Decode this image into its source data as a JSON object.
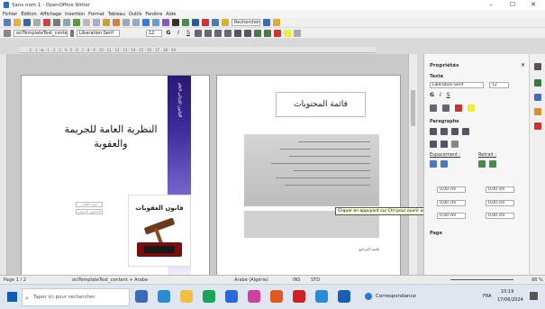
{
  "window": {
    "title": "Sans nom 1 - OpenOffice Writer",
    "minimize": "–",
    "maximize": "☐",
    "close": "✕"
  },
  "menu": [
    "Fichier",
    "Édition",
    "Affichage",
    "Insertion",
    "Format",
    "Tableau",
    "Outils",
    "Fenêtre",
    "Aide"
  ],
  "toolbar": {
    "search_field": "Rechercher",
    "style_combo": "ociTemplateText_content",
    "font_combo": "Liberation Serif",
    "size_combo": "12",
    "bold": "G",
    "italic": "I",
    "underline": "S"
  },
  "ruler": {
    "ticks": "· 2 · 1 · ⊠ · 1 · 2 · 3 · 4 · 5 · 6 · 7 · 8 · 9 · 10 · 11 · 12 · 13 · 14 · 15 · 16 · 17 · 18 · 19"
  },
  "page1": {
    "title": "النظرية العامة للجريمة والعقوبة",
    "band_text": "القانون الجنائي العام",
    "field1": "اسم الطالب",
    "field2": "المستوى الدراسي",
    "card_title": "قانون العقوبات"
  },
  "page2": {
    "title": "قائمة المحتويات",
    "toc_last": "قائمة المراجع"
  },
  "tooltip": "Cliquer en appuyant sur Ctrl pour ouvrir un hyperlien : الرابط الشعبي",
  "sidebar": {
    "title": "Propriétés",
    "section_text": "Texte",
    "font": "Liberation Serif",
    "size": "12",
    "bold": "G",
    "italic": "I",
    "underline": "S",
    "section_paragraph": "Paragraphe",
    "spacing_label": "Espacement :",
    "indent_label": "Retrait :",
    "values": [
      "0,00 cm",
      "0,00 cm",
      "0,00 cm",
      "0,00 cm",
      "0,00 cm",
      "0,00 cm"
    ],
    "section_page": "Page"
  },
  "status": {
    "page": "Page 1 / 2",
    "style": "ociTemplateText_content + Arabe",
    "lang": "Arabe (Algérie)",
    "mode": "INS",
    "sel": "STD",
    "zoom": "98 %"
  },
  "taskbar": {
    "search_placeholder": "Taper ici pour rechercher",
    "weather": "Correspondance",
    "lang": "FRA",
    "time": "10:19",
    "date": "17/06/2024"
  },
  "colors": {
    "band_top": "#2a1870",
    "band_bottom": "#ffffff",
    "sidebar_bg": "#f6f6f6",
    "taskbar_bg": "#dfe6ef"
  }
}
